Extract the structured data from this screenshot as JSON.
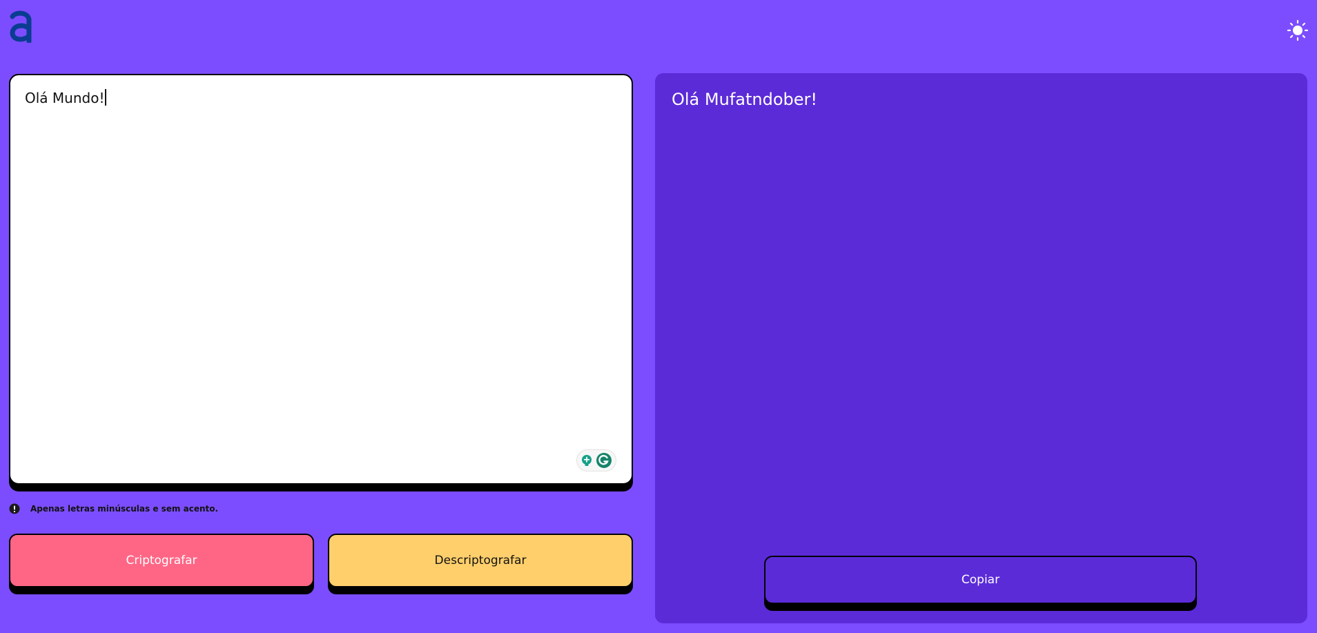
{
  "header": {
    "logo_icon": "letter-a-logo",
    "theme_toggle_icon": "sun-icon"
  },
  "input": {
    "value": "Olá Mundo!",
    "extension_icons": [
      "grammarly-bulb-icon",
      "grammarly-g-icon"
    ]
  },
  "hint": {
    "icon": "exclamation-circle-icon",
    "text": "Apenas letras minúsculas e sem acento."
  },
  "actions": {
    "encrypt_label": "Criptografar",
    "decrypt_label": "Descriptografar"
  },
  "output": {
    "text": "Olá Mufatndober!",
    "copy_label": "Copiar"
  },
  "colors": {
    "background": "#7c4dff",
    "output_panel": "#5b2bd8",
    "encrypt_button": "#ff6685",
    "decrypt_button": "#ffcf6b",
    "logo": "#0a3d91"
  }
}
